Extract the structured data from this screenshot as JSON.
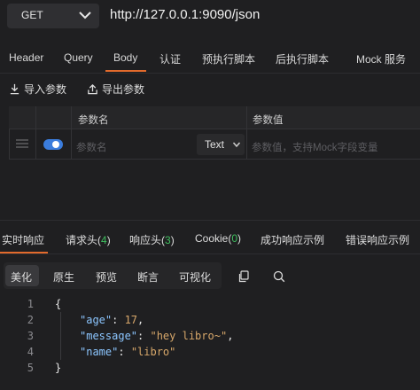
{
  "request": {
    "method": "GET",
    "url": "http://127.0.0.1:9090/json"
  },
  "request_tabs": [
    {
      "label": "Header"
    },
    {
      "label": "Query"
    },
    {
      "label": "Body",
      "active": true
    },
    {
      "label": "认证"
    },
    {
      "label": "预执行脚本"
    },
    {
      "label": "后执行脚本"
    },
    {
      "label": "Mock 服务"
    }
  ],
  "actions": {
    "import_label": "导入参数",
    "export_label": "导出参数"
  },
  "params_table": {
    "columns": [
      "参数名",
      "参数值"
    ],
    "row": {
      "enabled": true,
      "name_placeholder": "参数名",
      "type": "Text",
      "value_placeholder": "参数值，支持Mock字段变量"
    }
  },
  "response_tabs": [
    {
      "label": "实时响应",
      "active": true
    },
    {
      "label": "请求头",
      "count": "4"
    },
    {
      "label": "响应头",
      "count": "3"
    },
    {
      "label": "Cookie",
      "count": "0"
    },
    {
      "label": "成功响应示例"
    },
    {
      "label": "错误响应示例"
    }
  ],
  "view_modes": [
    {
      "label": "美化",
      "active": true
    },
    {
      "label": "原生"
    },
    {
      "label": "预览"
    },
    {
      "label": "断言"
    },
    {
      "label": "可视化"
    }
  ],
  "response_body": {
    "line_numbers": [
      "1",
      "2",
      "3",
      "4",
      "5"
    ],
    "lines": [
      "{",
      "\"age\": 17,",
      "\"message\": \"hey libro~\",",
      "\"name\": \"libro\"",
      "}"
    ],
    "fields": [
      {
        "key": "\"age\"",
        "value": "17"
      },
      {
        "key": "\"message\"",
        "value": "\"hey libro~\""
      },
      {
        "key": "\"name\"",
        "value": "\"libro\""
      }
    ]
  },
  "colors": {
    "accent": "#e26a2c",
    "toggle_on": "#3b7ddd",
    "count_green": "#3fbf5f",
    "json_key": "#8cc6ff",
    "json_value": "#d7a76a"
  },
  "icons": [
    "chevron-down-icon",
    "import-icon",
    "export-icon",
    "drag-handle-icon",
    "copy-icon",
    "search-icon"
  ]
}
